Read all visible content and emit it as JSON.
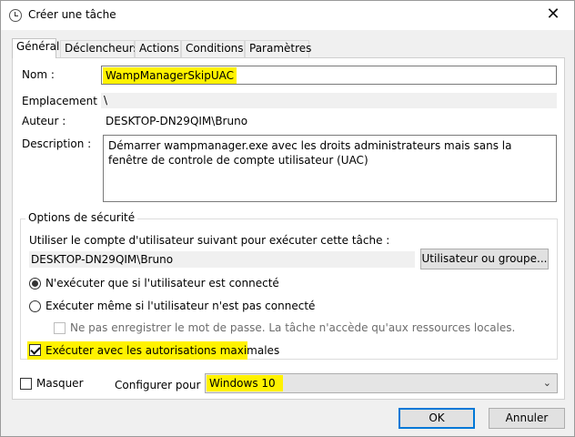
{
  "window": {
    "title": "Créer une tâche",
    "close_symbol": "✕"
  },
  "tabs": [
    {
      "label": "Général",
      "active": true
    },
    {
      "label": "Déclencheurs",
      "active": false
    },
    {
      "label": "Actions",
      "active": false
    },
    {
      "label": "Conditions",
      "active": false
    },
    {
      "label": "Paramètres",
      "active": false
    }
  ],
  "general": {
    "name_label": "Nom :",
    "name_value": "WampManagerSkipUAC",
    "location_label": "Emplacement :",
    "location_value": "\\",
    "author_label": "Auteur :",
    "author_value": "DESKTOP-DN29QIM\\Bruno",
    "description_label": "Description :",
    "description_value": "Démarrer wampmanager.exe avec les droits administrateurs mais sans la fenêtre de controle de compte utilisateur (UAC)"
  },
  "security": {
    "group_title": "Options de sécurité",
    "account_prompt": "Utiliser le compte d'utilisateur suivant pour exécuter cette tâche :",
    "account_value": "DESKTOP-DN29QIM\\Bruno",
    "user_group_button": "Utilisateur ou groupe...",
    "radio_logged_on": "N'exécuter que si l'utilisateur est connecté",
    "radio_logged_on_selected": true,
    "radio_any": "Exécuter même si l'utilisateur n'est pas connecté",
    "radio_any_selected": false,
    "no_store_password": "Ne pas enregistrer le mot de passe. La tâche n'accède qu'aux ressources locales.",
    "no_store_password_checked": false,
    "highest_privileges": "Exécuter avec les autorisations maximales",
    "highest_privileges_checked": true
  },
  "bottom": {
    "hidden_label": "Masquer",
    "hidden_checked": false,
    "configure_label": "Configurer pour :",
    "configure_value": "Windows 10",
    "dropdown_arrow": "⌄"
  },
  "footer": {
    "ok_label": "OK",
    "cancel_label": "Annuler"
  },
  "colors": {
    "highlight": "#fff200",
    "accent_border": "#0078d7"
  }
}
